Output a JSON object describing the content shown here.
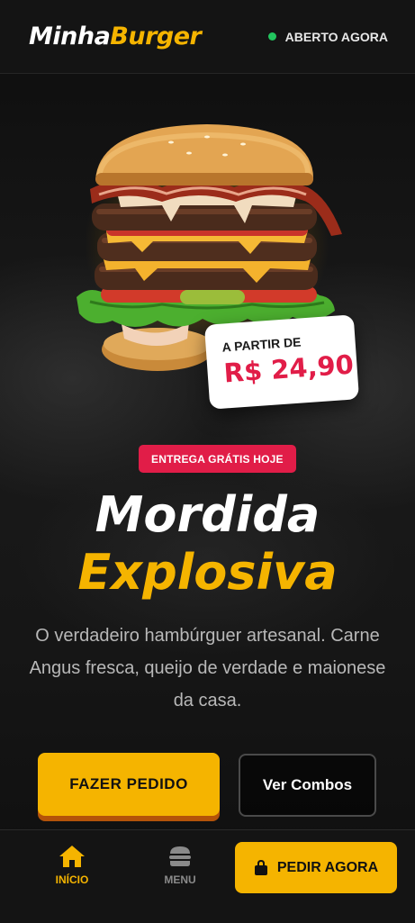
{
  "header": {
    "logo_white": "Minha",
    "logo_yellow": "Burger",
    "status_label": "ABERTO AGORA",
    "status_color": "#22c55e"
  },
  "hero": {
    "image_icon": "burger-image",
    "price_from_label": "A PARTIR DE",
    "price_value": "R$ 24,90",
    "badge_label": "ENTREGA GRÁTIS HOJE",
    "title_line1": "Mordida",
    "title_line2": "Explosiva",
    "description_lines": [
      "O verdadeiro hambúrguer artesanal. Carne",
      "Angus fresca, queijo de verdade e maionese",
      "da casa."
    ],
    "primary_button": "FAZER PEDIDO",
    "secondary_button": "Ver Combos"
  },
  "nav": {
    "home_label": "INÍCIO",
    "home_icon": "home-icon",
    "menu_label": "MENU",
    "menu_icon": "burger-menu-icon",
    "order_label": "PEDIR AGORA",
    "order_icon": "shopping-bag-icon"
  },
  "colors": {
    "accent": "#f5b400",
    "highlight": "#e11d48",
    "background": "#121212"
  }
}
